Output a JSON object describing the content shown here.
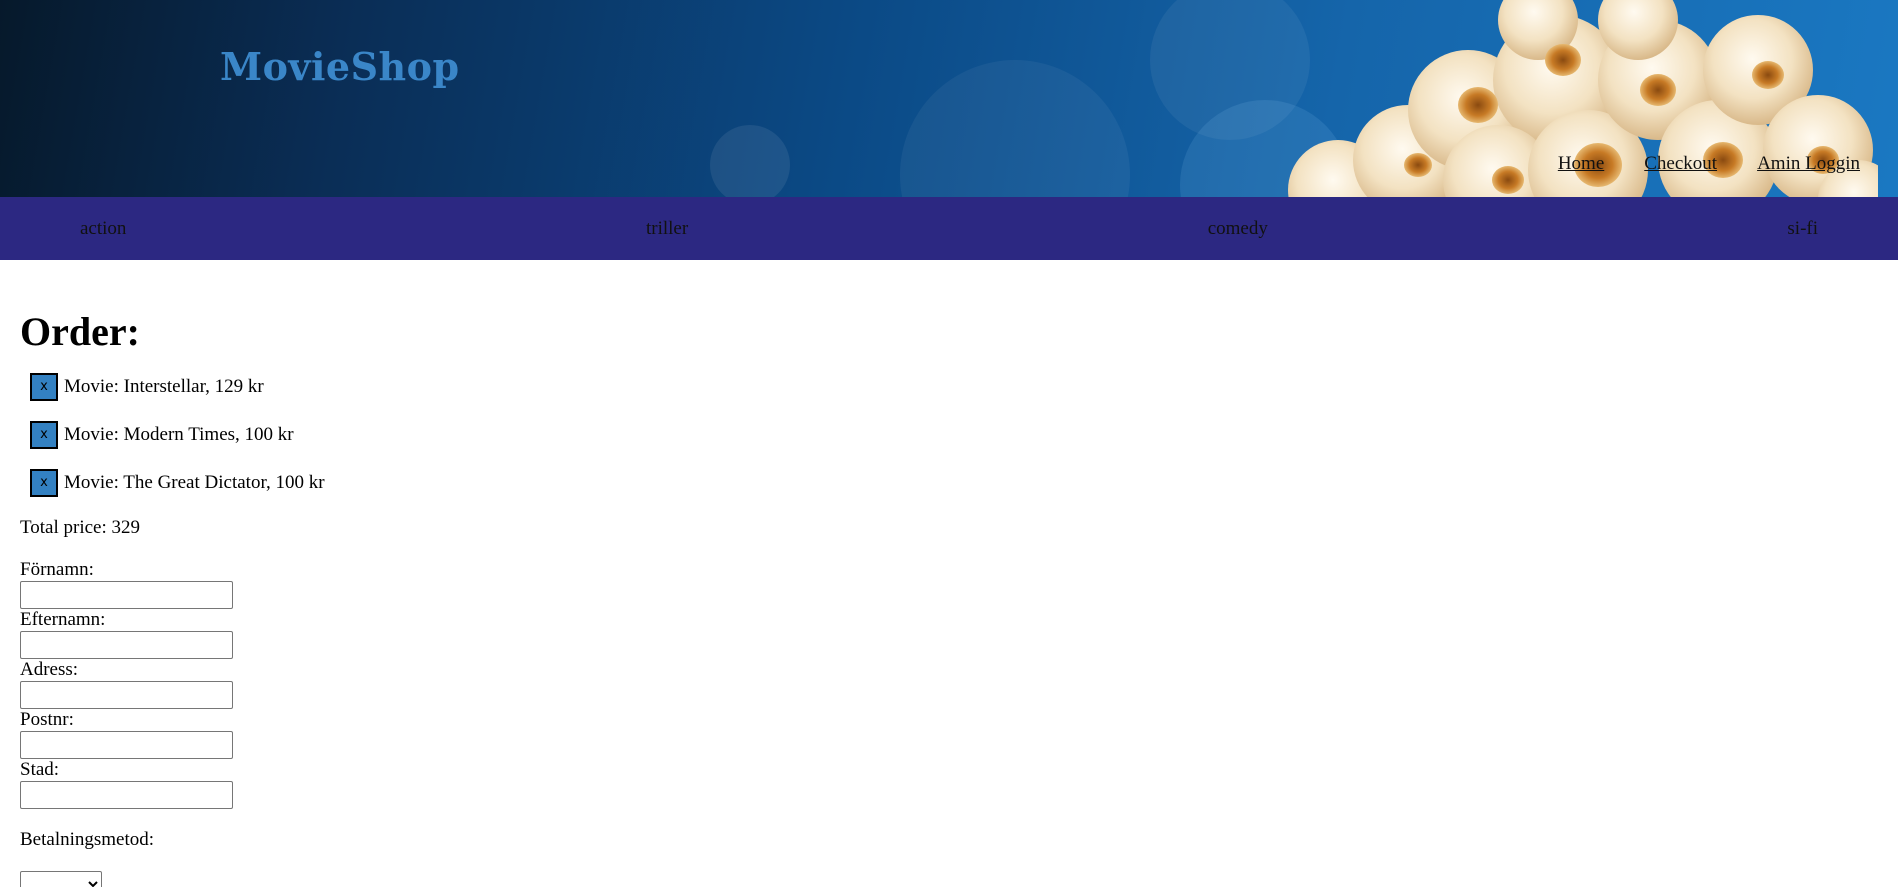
{
  "header": {
    "logo": "MovieShop",
    "links": [
      "Home",
      "Checkout",
      "Amin Loggin"
    ]
  },
  "categories": [
    "action",
    "triller",
    "comedy",
    "si-fi"
  ],
  "order": {
    "title": "Order:",
    "remove_label": "x",
    "items": [
      "Movie: Interstellar, 129 kr",
      "Movie: Modern Times, 100 kr",
      "Movie: The Great Dictator, 100 kr"
    ],
    "total": "Total price: 329"
  },
  "form": {
    "fields": [
      "Förnamn:",
      "Efternamn:",
      "Adress:",
      "Postnr:",
      "Stad:"
    ],
    "payment_label": "Betalningsmetod:"
  },
  "colors": {
    "nav_bar": "#2c2882",
    "logo": "#3a86c8",
    "remove_button": "#3381c2"
  }
}
